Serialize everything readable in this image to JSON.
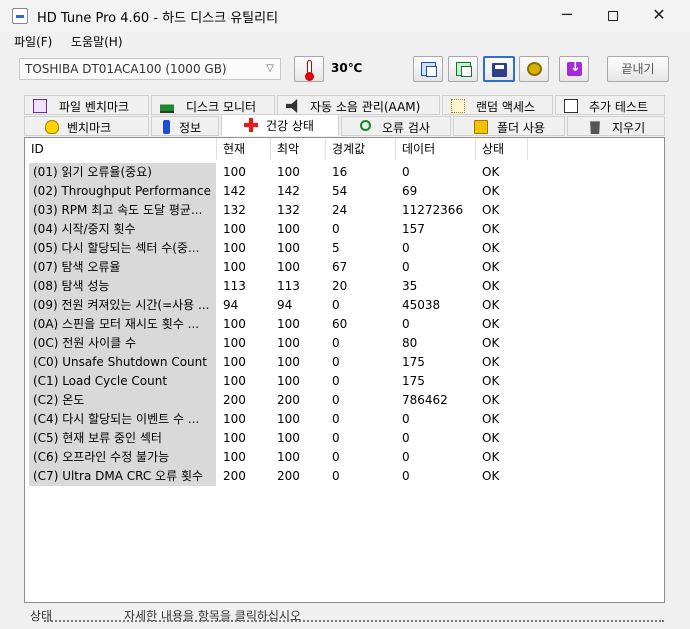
{
  "window": {
    "title": "HD Tune Pro 4.60 - 하드 디스크 유틸리티"
  },
  "menu": [
    {
      "label": "파일(F)"
    },
    {
      "label": "도움말(H)"
    }
  ],
  "toolbar": {
    "drive": "TOSHIBA DT01ACA100 (1000 GB)",
    "temperature": "30℃",
    "exit_label": "끝내기"
  },
  "tabs_row1": [
    {
      "label": "파일 벤치마크",
      "icon": "file-benchmark-icon"
    },
    {
      "label": "디스크 모니터",
      "icon": "disk-monitor-icon"
    },
    {
      "label": "자동 소음 관리(AAM)",
      "icon": "speaker-icon"
    },
    {
      "label": "랜덤 액세스",
      "icon": "random-access-icon"
    },
    {
      "label": "추가 테스트",
      "icon": "extra-tests-icon"
    }
  ],
  "tabs_row2": [
    {
      "label": "벤치마크",
      "icon": "bulb-icon"
    },
    {
      "label": "정보",
      "icon": "info-icon"
    },
    {
      "label": "건강 상태",
      "icon": "health-cross-icon",
      "active": true
    },
    {
      "label": "오류 검사",
      "icon": "magnifier-icon"
    },
    {
      "label": "폴더 사용",
      "icon": "folder-icon"
    },
    {
      "label": "지우기",
      "icon": "trash-icon"
    }
  ],
  "table": {
    "columns": [
      "ID",
      "현재",
      "최악",
      "경계값",
      "데이터",
      "상태"
    ],
    "rows": [
      [
        "(01) 읽기 오류율(중요)",
        "100",
        "100",
        "16",
        "0",
        "OK"
      ],
      [
        "(02) Throughput Performance  ...",
        "142",
        "142",
        "54",
        "69",
        "OK"
      ],
      [
        "(03) RPM 최고 속도 도달 평균...",
        "132",
        "132",
        "24",
        "11272366",
        "OK"
      ],
      [
        "(04) 시작/중지 횟수",
        "100",
        "100",
        "0",
        "157",
        "OK"
      ],
      [
        "(05) 다시 할당되는 섹터 수(중...",
        "100",
        "100",
        "5",
        "0",
        "OK"
      ],
      [
        "(07) 탐색 오류율",
        "100",
        "100",
        "67",
        "0",
        "OK"
      ],
      [
        "(08) 탐색 성능",
        "113",
        "113",
        "20",
        "35",
        "OK"
      ],
      [
        "(09) 전원 켜져있는 시간(=사용 ...",
        "94",
        "94",
        "0",
        "45038",
        "OK"
      ],
      [
        "(0A) 스핀을 모터 재시도 횟수 ...",
        "100",
        "100",
        "60",
        "0",
        "OK"
      ],
      [
        "(0C) 전원 사이클 수",
        "100",
        "100",
        "0",
        "80",
        "OK"
      ],
      [
        "(C0) Unsafe Shutdown Count",
        "100",
        "100",
        "0",
        "175",
        "OK"
      ],
      [
        "(C1) Load Cycle Count",
        "100",
        "100",
        "0",
        "175",
        "OK"
      ],
      [
        "(C2) 온도",
        "200",
        "200",
        "0",
        "786462",
        "OK"
      ],
      [
        "(C4) 다시 할당되는 이벤트 수 ...",
        "100",
        "100",
        "0",
        "0",
        "OK"
      ],
      [
        "(C5) 현재 보류 중인 섹터",
        "100",
        "100",
        "0",
        "0",
        "OK"
      ],
      [
        "(C6) 오프라인 수정 불가능",
        "100",
        "100",
        "0",
        "0",
        "OK"
      ],
      [
        "(C7) Ultra DMA CRC 오류 횟수",
        "200",
        "200",
        "0",
        "0",
        "OK"
      ]
    ]
  },
  "bottom": {
    "left": "상태",
    "hint": "자세한 내용을 항목을 클릭하십시오"
  }
}
